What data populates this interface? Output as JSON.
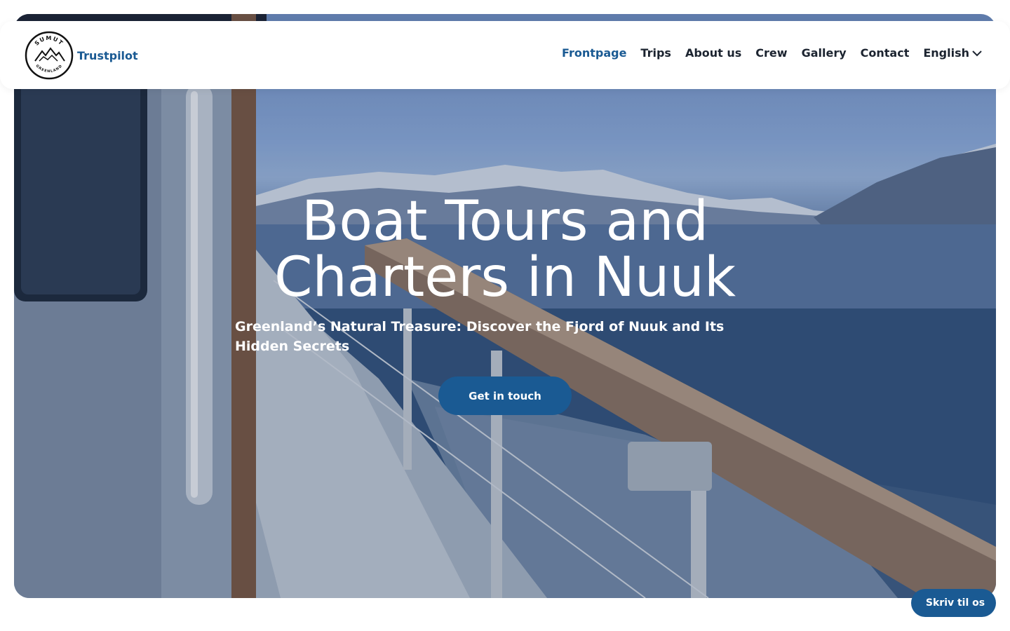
{
  "header": {
    "logo": {
      "top_text": "SUMUT",
      "bottom_text": "GREENLAND"
    },
    "trustpilot_label": "Trustpilot",
    "nav": [
      {
        "label": "Frontpage",
        "active": true
      },
      {
        "label": "Trips"
      },
      {
        "label": "About us"
      },
      {
        "label": "Crew"
      },
      {
        "label": "Gallery"
      },
      {
        "label": "Contact"
      }
    ],
    "language": {
      "label": "English",
      "icon": "chevron-down-icon"
    }
  },
  "hero": {
    "title_line1": "Boat Tours and",
    "title_line2": "Charters in Nuuk",
    "subtitle": "Greenland’s Natural Treasure: Discover the Fjord of Nuuk and Its Hidden Secrets",
    "cta_label": "Get in touch"
  },
  "chat_widget": {
    "icon_glyph": "",
    "label": "Skriv til os"
  },
  "colors": {
    "brand_blue": "#1a5a93",
    "nav_text": "#1c2430",
    "header_bg": "#ffffff"
  }
}
